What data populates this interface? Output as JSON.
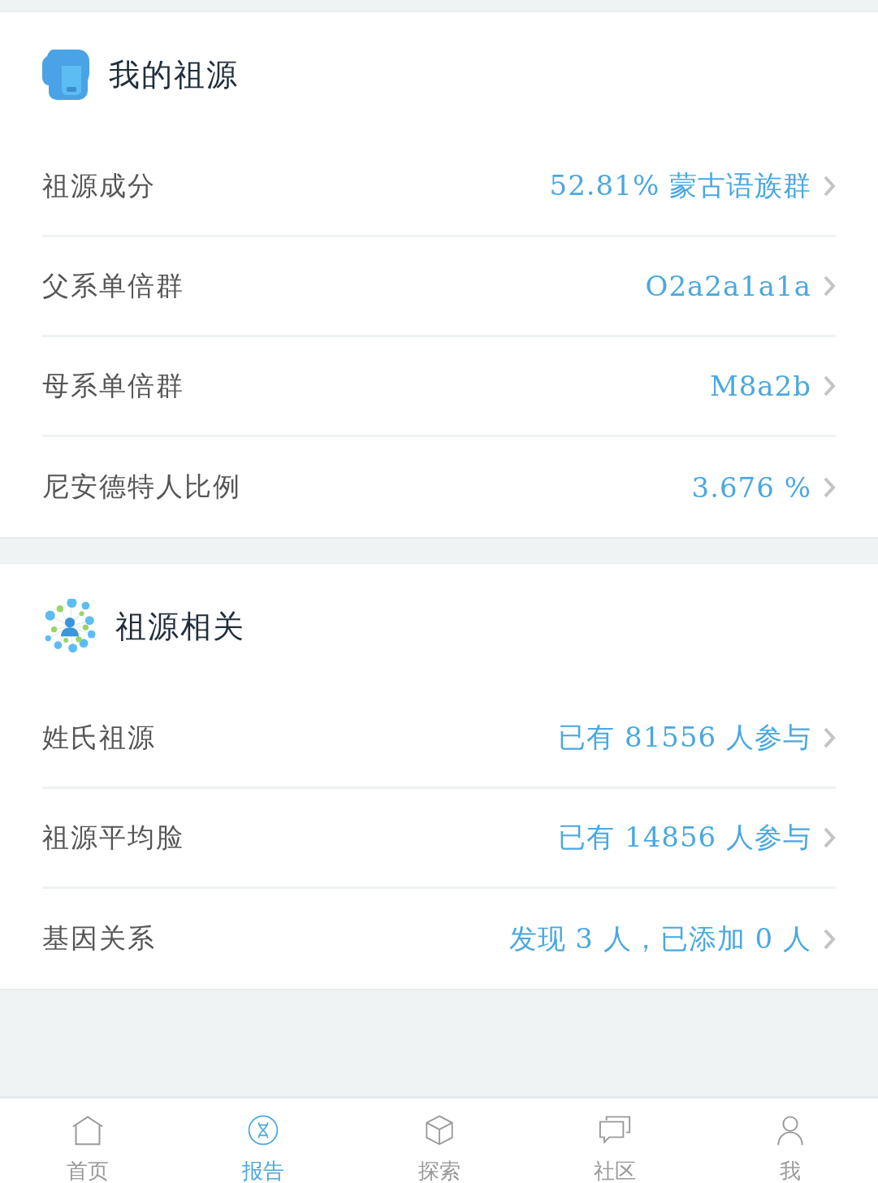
{
  "sections": [
    {
      "title": "我的祖源",
      "rows": [
        {
          "label": "祖源成分",
          "value": "52.81% 蒙古语族群"
        },
        {
          "label": "父系单倍群",
          "value": "O2a2a1a1a"
        },
        {
          "label": "母系单倍群",
          "value": "M8a2b"
        },
        {
          "label": "尼安德特人比例",
          "value": "3.676 %"
        }
      ]
    },
    {
      "title": "祖源相关",
      "rows": [
        {
          "label": "姓氏祖源",
          "value": "已有 81556 人参与"
        },
        {
          "label": "祖源平均脸",
          "value": "已有 14856 人参与"
        },
        {
          "label": "基因关系",
          "value": "发现 3 人，已添加 0 人"
        }
      ]
    }
  ],
  "tab_bar": [
    {
      "label": "首页",
      "selected": false
    },
    {
      "label": "报告",
      "selected": true
    },
    {
      "label": "探索",
      "selected": false
    },
    {
      "label": "社区",
      "selected": false
    },
    {
      "label": "我",
      "selected": false
    }
  ]
}
